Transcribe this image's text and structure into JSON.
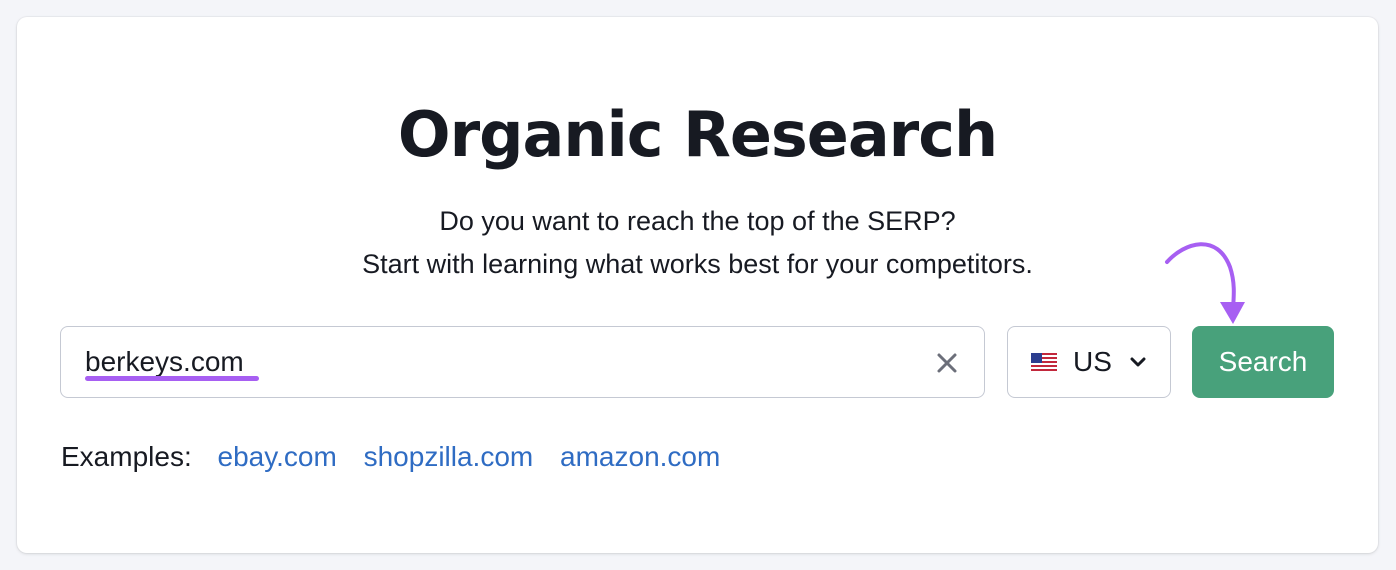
{
  "page": {
    "title": "Organic Research",
    "subtitle_line1": "Do you want to reach the top of the SERP?",
    "subtitle_line2": "Start with learning what works best for your competitors."
  },
  "search": {
    "value": "berkeys.com",
    "clear_icon": "close-icon",
    "button_label": "Search"
  },
  "country": {
    "flag_icon": "us-flag-icon",
    "selected": "US",
    "chevron_icon": "chevron-down-icon"
  },
  "examples": {
    "label": "Examples:",
    "links": [
      "ebay.com",
      "shopzilla.com",
      "amazon.com"
    ]
  },
  "colors": {
    "accent_purple": "#a75ff2",
    "button_green": "#48a17b",
    "link_blue": "#2f6cc3",
    "text_dark": "#171a22",
    "page_bg": "#f4f5f9"
  }
}
